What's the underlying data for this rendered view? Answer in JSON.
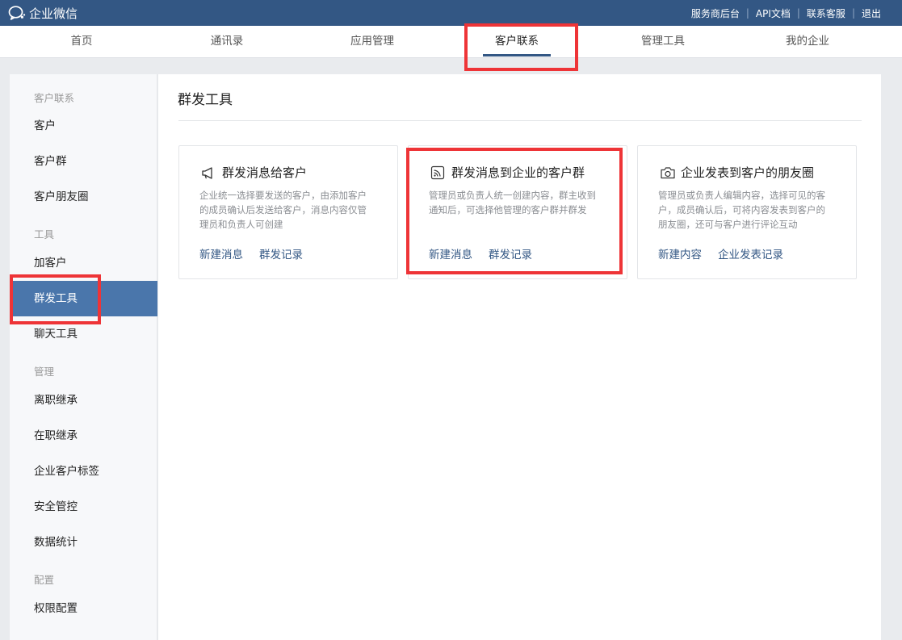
{
  "app": {
    "name": "企业微信"
  },
  "top_links": [
    "服务商后台",
    "API文档",
    "联系客服",
    "退出"
  ],
  "nav": {
    "tabs": [
      {
        "label": "首页"
      },
      {
        "label": "通讯录"
      },
      {
        "label": "应用管理"
      },
      {
        "label": "客户联系",
        "active": true
      },
      {
        "label": "管理工具"
      },
      {
        "label": "我的企业"
      }
    ]
  },
  "sidebar": {
    "sections": [
      {
        "heading": "客户联系",
        "items": [
          "客户",
          "客户群",
          "客户朋友圈"
        ]
      },
      {
        "heading": "工具",
        "items": [
          "加客户",
          "群发工具",
          "聊天工具"
        ]
      },
      {
        "heading": "管理",
        "items": [
          "离职继承",
          "在职继承",
          "企业客户标签",
          "安全管控",
          "数据统计"
        ]
      },
      {
        "heading": "配置",
        "items": [
          "权限配置"
        ]
      }
    ],
    "active_item": "群发工具"
  },
  "main": {
    "title": "群发工具",
    "cards": [
      {
        "icon": "megaphone-icon",
        "title": "群发消息给客户",
        "desc": [
          "企业统一选择要发送的客户，由添加客户",
          "的成员确认后发送给客户，消息内容仅管",
          "理员和负责人可创建"
        ],
        "links": [
          "新建消息",
          "群发记录"
        ]
      },
      {
        "icon": "broadcast-icon",
        "title": "群发消息到企业的客户群",
        "desc": [
          "管理员或负责人统一创建内容，群主收到",
          "通知后，可选择他管理的客户群并群发"
        ],
        "links": [
          "新建消息",
          "群发记录"
        ]
      },
      {
        "icon": "camera-icon",
        "title": "企业发表到客户的朋友圈",
        "desc": [
          "管理员或负责人编辑内容，选择可见的客",
          "户，成员确认后，可将内容发表到客户的",
          "朋友圈，还可与客户进行评论互动"
        ],
        "links": [
          "新建内容",
          "企业发表记录"
        ]
      }
    ]
  },
  "colors": {
    "topbar": "#335784",
    "accent": "#4a76ab",
    "link": "#335784",
    "highlight": "#ee3437"
  }
}
